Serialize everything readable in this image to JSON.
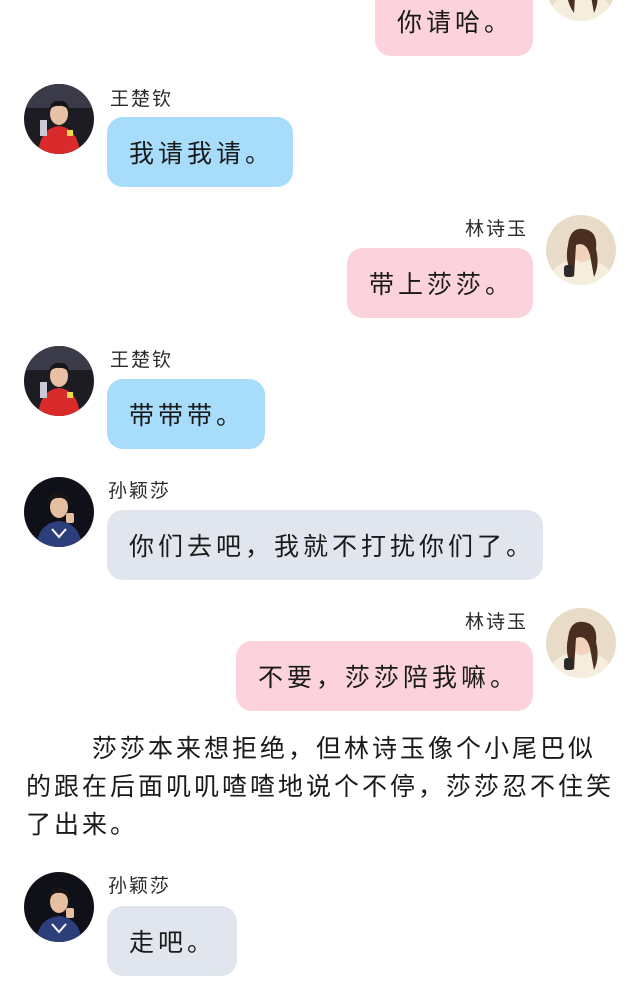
{
  "messages": [
    {
      "id": "m1",
      "side": "right",
      "speaker": "lin",
      "name": "",
      "text": "你请哈。",
      "color": "pink"
    },
    {
      "id": "m2",
      "side": "left",
      "speaker": "wang",
      "name": "王楚钦",
      "text": "我请我请。",
      "color": "blue"
    },
    {
      "id": "m3",
      "side": "right",
      "speaker": "lin",
      "name": "林诗玉",
      "text": "带上莎莎。",
      "color": "pink"
    },
    {
      "id": "m4",
      "side": "left",
      "speaker": "wang",
      "name": "王楚钦",
      "text": "带带带。",
      "color": "blue"
    },
    {
      "id": "m5",
      "side": "left",
      "speaker": "sun",
      "name": "孙颖莎",
      "text": "你们去吧，我就不打扰你们了。",
      "color": "gray"
    },
    {
      "id": "m6",
      "side": "right",
      "speaker": "lin",
      "name": "林诗玉",
      "text": "不要，莎莎陪我嘛。",
      "color": "pink"
    },
    {
      "id": "m7",
      "side": "left",
      "speaker": "sun",
      "name": "孙颖莎",
      "text": "走吧。",
      "color": "gray"
    }
  ],
  "narration": "莎莎本来想拒绝，但林诗玉像个小尾巴似的跟在后面叽叽喳喳地说个不停，莎莎忍不住笑了出来。",
  "colors": {
    "pink_bubble": "#fcd3dd",
    "blue_bubble": "#a7dcfa",
    "gray_bubble": "#e1e5ee"
  }
}
